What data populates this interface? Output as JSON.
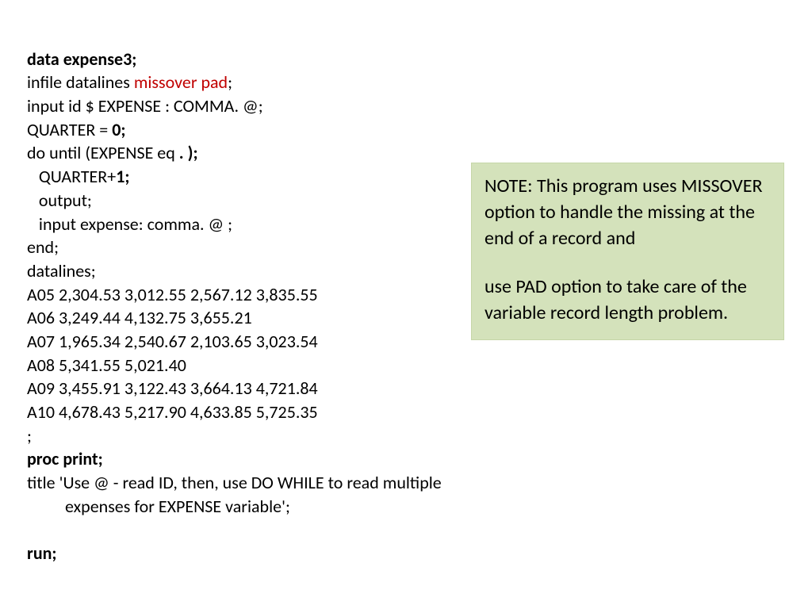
{
  "code": {
    "l1_bold": "data expense3;",
    "l2a": "infile datalines ",
    "l2_red": "missover pad",
    "l2b": ";",
    "l3": "input id $ EXPENSE : COMMA. @;",
    "l4a": "QUARTER = ",
    "l4_bold": "0;",
    "l5a": "do until (EXPENSE eq ",
    "l5_bold": ". );",
    "l6a": "   QUARTER+",
    "l6_bold": "1;",
    "l7": "   output;",
    "l8": "   input expense: comma. @ ;",
    "l9": "end;",
    "l10": "datalines;",
    "l11": "A05 2,304.53 3,012.55 2,567.12 3,835.55",
    "l12": "A06 3,249.44 4,132.75 3,655.21",
    "l13": "A07 1,965.34 2,540.67 2,103.65 3,023.54",
    "l14": "A08 5,341.55 5,021.40",
    "l15": "A09 3,455.91 3,122.43 3,664.13 4,721.84",
    "l16": "A10 4,678.43 5,217.90 4,633.85 5,725.35",
    "l17": ";",
    "l18_bold": "proc print;",
    "l19": "title 'Use @ - read ID, then, use DO WHILE to read multiple expenses  for EXPENSE variable';",
    "l20_bold": "run;"
  },
  "note": {
    "para1": "NOTE: This program uses MISSOVER option to handle the missing at the end of a record and",
    "para2": "use PAD option to take care of the variable record length problem."
  }
}
